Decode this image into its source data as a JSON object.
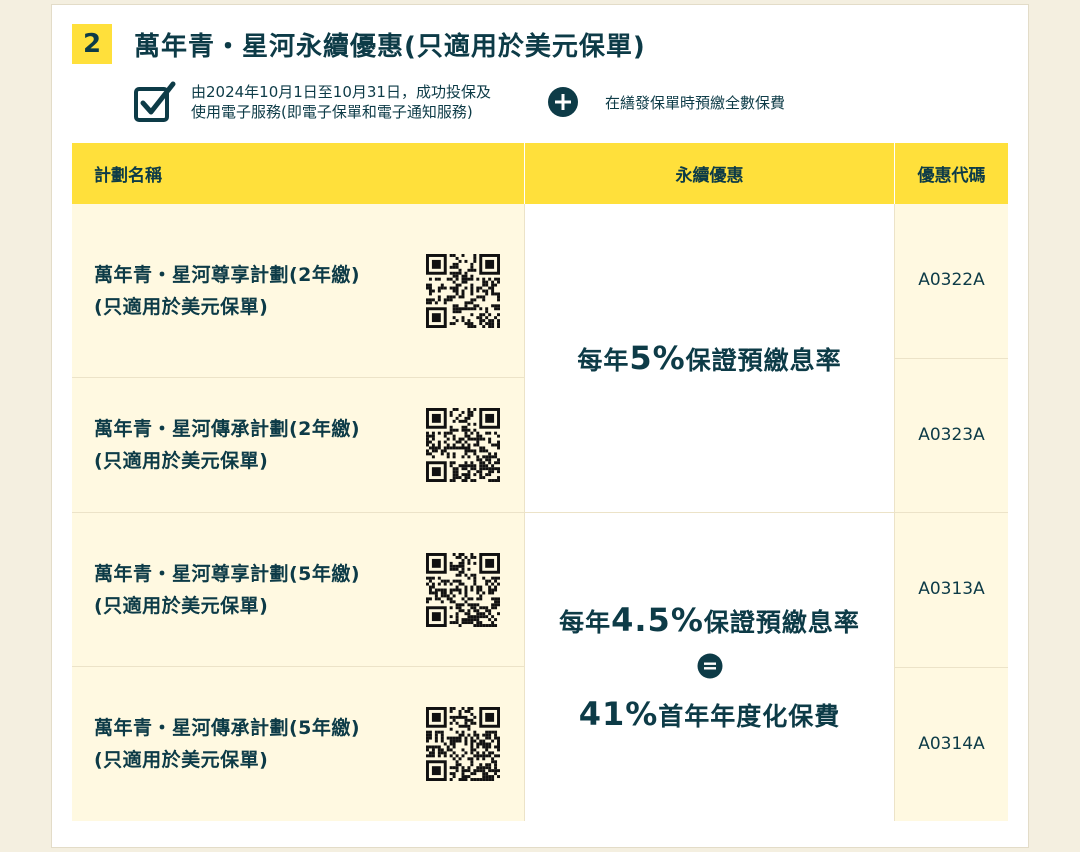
{
  "section": {
    "number": "2",
    "title": "萬年青・星河永續優惠(只適用於美元保單)"
  },
  "conditions": {
    "line1": "由2024年10月1日至10月31日，成功投保及",
    "line2": "使用電子服務(即電子保單和電子通知服務)",
    "extra": "在繕發保單時預繳全數保費"
  },
  "table": {
    "headers": [
      "計劃名稱",
      "永續優惠",
      "優惠代碼"
    ],
    "rows": [
      {
        "name_line1": "萬年青・星河尊享計劃(2年繳)",
        "name_line2": "(只適用於美元保單)",
        "code": "A0322A"
      },
      {
        "name_line1": "萬年青・星河傳承計劃(2年繳)",
        "name_line2": "(只適用於美元保單)",
        "code": "A0323A"
      },
      {
        "name_line1": "萬年青・星河尊享計劃(5年繳)",
        "name_line2": "(只適用於美元保單)",
        "code": "A0313A"
      },
      {
        "name_line1": "萬年青・星河傳承計劃(5年繳)",
        "name_line2": "(只適用於美元保單)",
        "code": "A0314A"
      }
    ],
    "offer_a": {
      "prefix": "每年",
      "value": "5%",
      "suffix": "保證預繳息率"
    },
    "offer_b": {
      "prefix": "每年",
      "value": "4.5%",
      "suffix": "保證預繳息率",
      "equals_value": "41%",
      "equals_suffix": "首年年度化保費"
    }
  },
  "colors": {
    "accent_yellow": "#ffe03b",
    "text_navy": "#0d3b47",
    "cell_cream": "#fff9e1"
  },
  "icons": {
    "check": "checkbox-checked-icon",
    "plus": "plus-circle-icon",
    "equals": "equals-circle-icon",
    "qr": "qr-code-icon"
  }
}
